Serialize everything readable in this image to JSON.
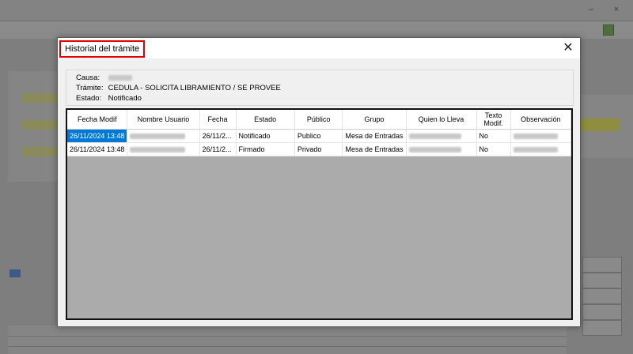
{
  "dialog": {
    "title": "Historial del trámite",
    "close_icon": "close-icon"
  },
  "info": {
    "causa_label": "Causa:",
    "tramite_label": "Trámite:",
    "tramite_value": "CEDULA - SOLICITA LIBRAMIENTO / SE PROVEE",
    "estado_label": "Estado:",
    "estado_value": "Notificado"
  },
  "table": {
    "columns": [
      "Fecha Modif",
      "Nombre Usuario",
      "Fecha",
      "Estado",
      "Público",
      "Grupo",
      "Quien lo Lleva",
      "Texto Modif.",
      "Observación"
    ],
    "rows": [
      {
        "fecha_modif": "26/11/2024 13:48",
        "fecha": "26/11/2...",
        "estado": "Notificado",
        "publico": "Publico",
        "grupo": "Mesa de Entradas",
        "texto_modif": "No",
        "selected": true
      },
      {
        "fecha_modif": "26/11/2024 13:48",
        "fecha": "26/11/2...",
        "estado": "Firmado",
        "publico": "Privado",
        "grupo": "Mesa de Entradas",
        "texto_modif": "No",
        "selected": false
      }
    ]
  }
}
